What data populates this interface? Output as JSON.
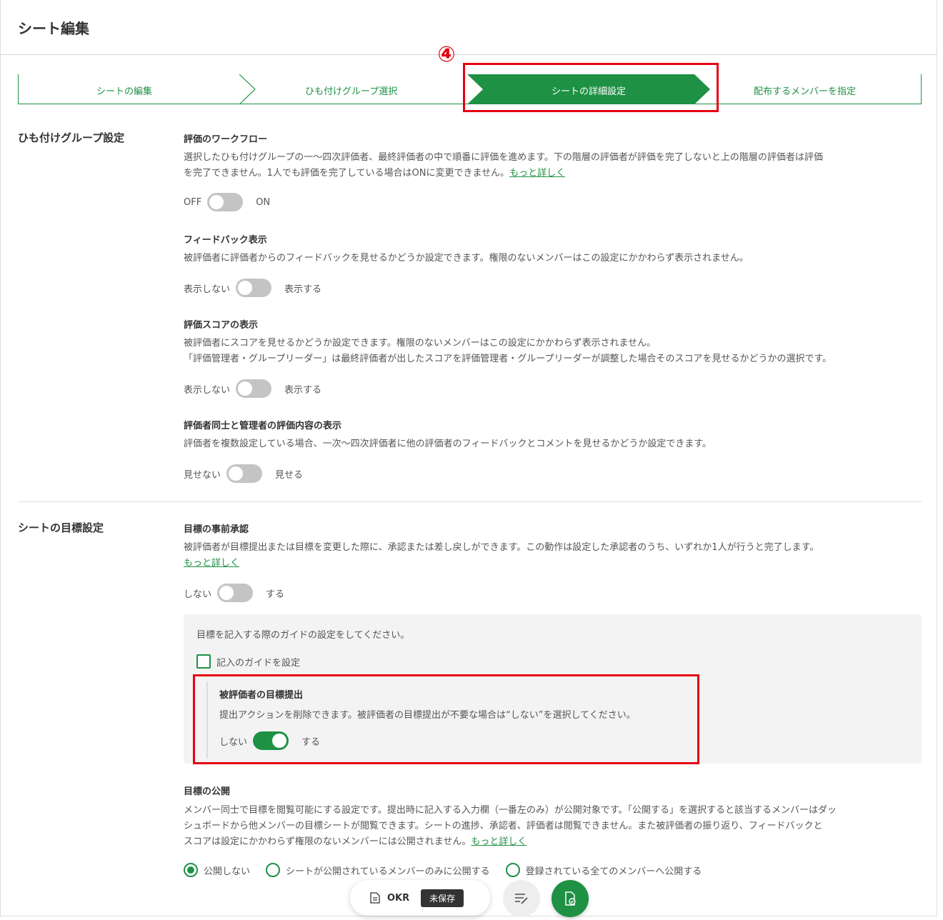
{
  "page": {
    "title": "シート編集"
  },
  "steps": [
    {
      "label": "シートの編集"
    },
    {
      "label": "ひも付けグループ選択"
    },
    {
      "label": "シートの詳細設定"
    },
    {
      "label": "配布するメンバーを指定"
    }
  ],
  "annotation": {
    "step_number": "④"
  },
  "group_settings": {
    "label": "ひも付けグループ設定",
    "workflow": {
      "title": "評価のワークフロー",
      "desc_line1": "選択したひも付けグループの一～四次評価者、最終評価者の中で順番に評価を進めます。下の階層の評価者が評価を完了しないと上の階層の評価者は評価",
      "desc_line2": "を完了できません。1人でも評価を完了している場合はONに変更できません。",
      "link": "もっと詳しく",
      "off_label": "OFF",
      "on_label": "ON"
    },
    "feedback": {
      "title": "フィードバック表示",
      "desc": "被評価者に評価者からのフィードバックを見せるかどうか設定できます。権限のないメンバーはこの設定にかかわらず表示されません。",
      "off_label": "表示しない",
      "on_label": "表示する"
    },
    "score": {
      "title": "評価スコアの表示",
      "desc_line1": "被評価者にスコアを見せるかどうか設定できます。権限のないメンバーはこの設定にかかわらず表示されません。",
      "desc_line2": "「評価管理者・グループリーダー」は最終評価者が出したスコアを評価管理者・グループリーダーが調整した場合そのスコアを見せるかどうかの選択です。",
      "off_label": "表示しない",
      "on_label": "表示する"
    },
    "peer": {
      "title": "評価者同士と管理者の評価内容の表示",
      "desc": "評価者を複数設定している場合、一次～四次評価者に他の評価者のフィードバックとコメントを見せるかどうか設定できます。",
      "off_label": "見せない",
      "on_label": "見せる"
    }
  },
  "goal_settings": {
    "label": "シートの目標設定",
    "pre_approval": {
      "title": "目標の事前承認",
      "desc": "被評価者が目標提出または目標を変更した際に、承認または差し戻しができます。この動作は設定した承認者のうち、いずれか1人が行うと完了します。",
      "link": "もっと詳しく",
      "off_label": "しない",
      "on_label": "する"
    },
    "guide": {
      "text": "目標を記入する際のガイドの設定をしてください。",
      "checkbox_label": "記入のガイドを設定",
      "submission": {
        "title": "被評価者の目標提出",
        "desc": "提出アクションを削除できます。被評価者の目標提出が不要な場合は“しない”を選択してください。",
        "off_label": "しない",
        "on_label": "する"
      }
    },
    "publish": {
      "title": "目標の公開",
      "desc_line1": "メンバー同士で目標を閲覧可能にする設定です。提出時に記入する入力欄（一番左のみ）が公開対象です。「公開する」を選択すると該当するメンバーはダッ",
      "desc_line2": "シュボードから他メンバーの目標シートが閲覧できます。シートの進捗、承認者、評価者は閲覧できません。また被評価者の振り返り、フィードバックと",
      "desc_line3": "スコアは設定にかかわらず権限のないメンバーには公開されません。",
      "link": "もっと詳しく",
      "options": [
        {
          "label": "公開しない"
        },
        {
          "label": "シートが公開されているメンバーのみに公開する"
        },
        {
          "label": "登録されている全てのメンバーへ公開する"
        }
      ]
    }
  },
  "bottom_bar": {
    "doc_label": "OKR",
    "status_badge": "未保存"
  },
  "colors": {
    "accent": "#1e9145",
    "highlight": "#e60012"
  }
}
